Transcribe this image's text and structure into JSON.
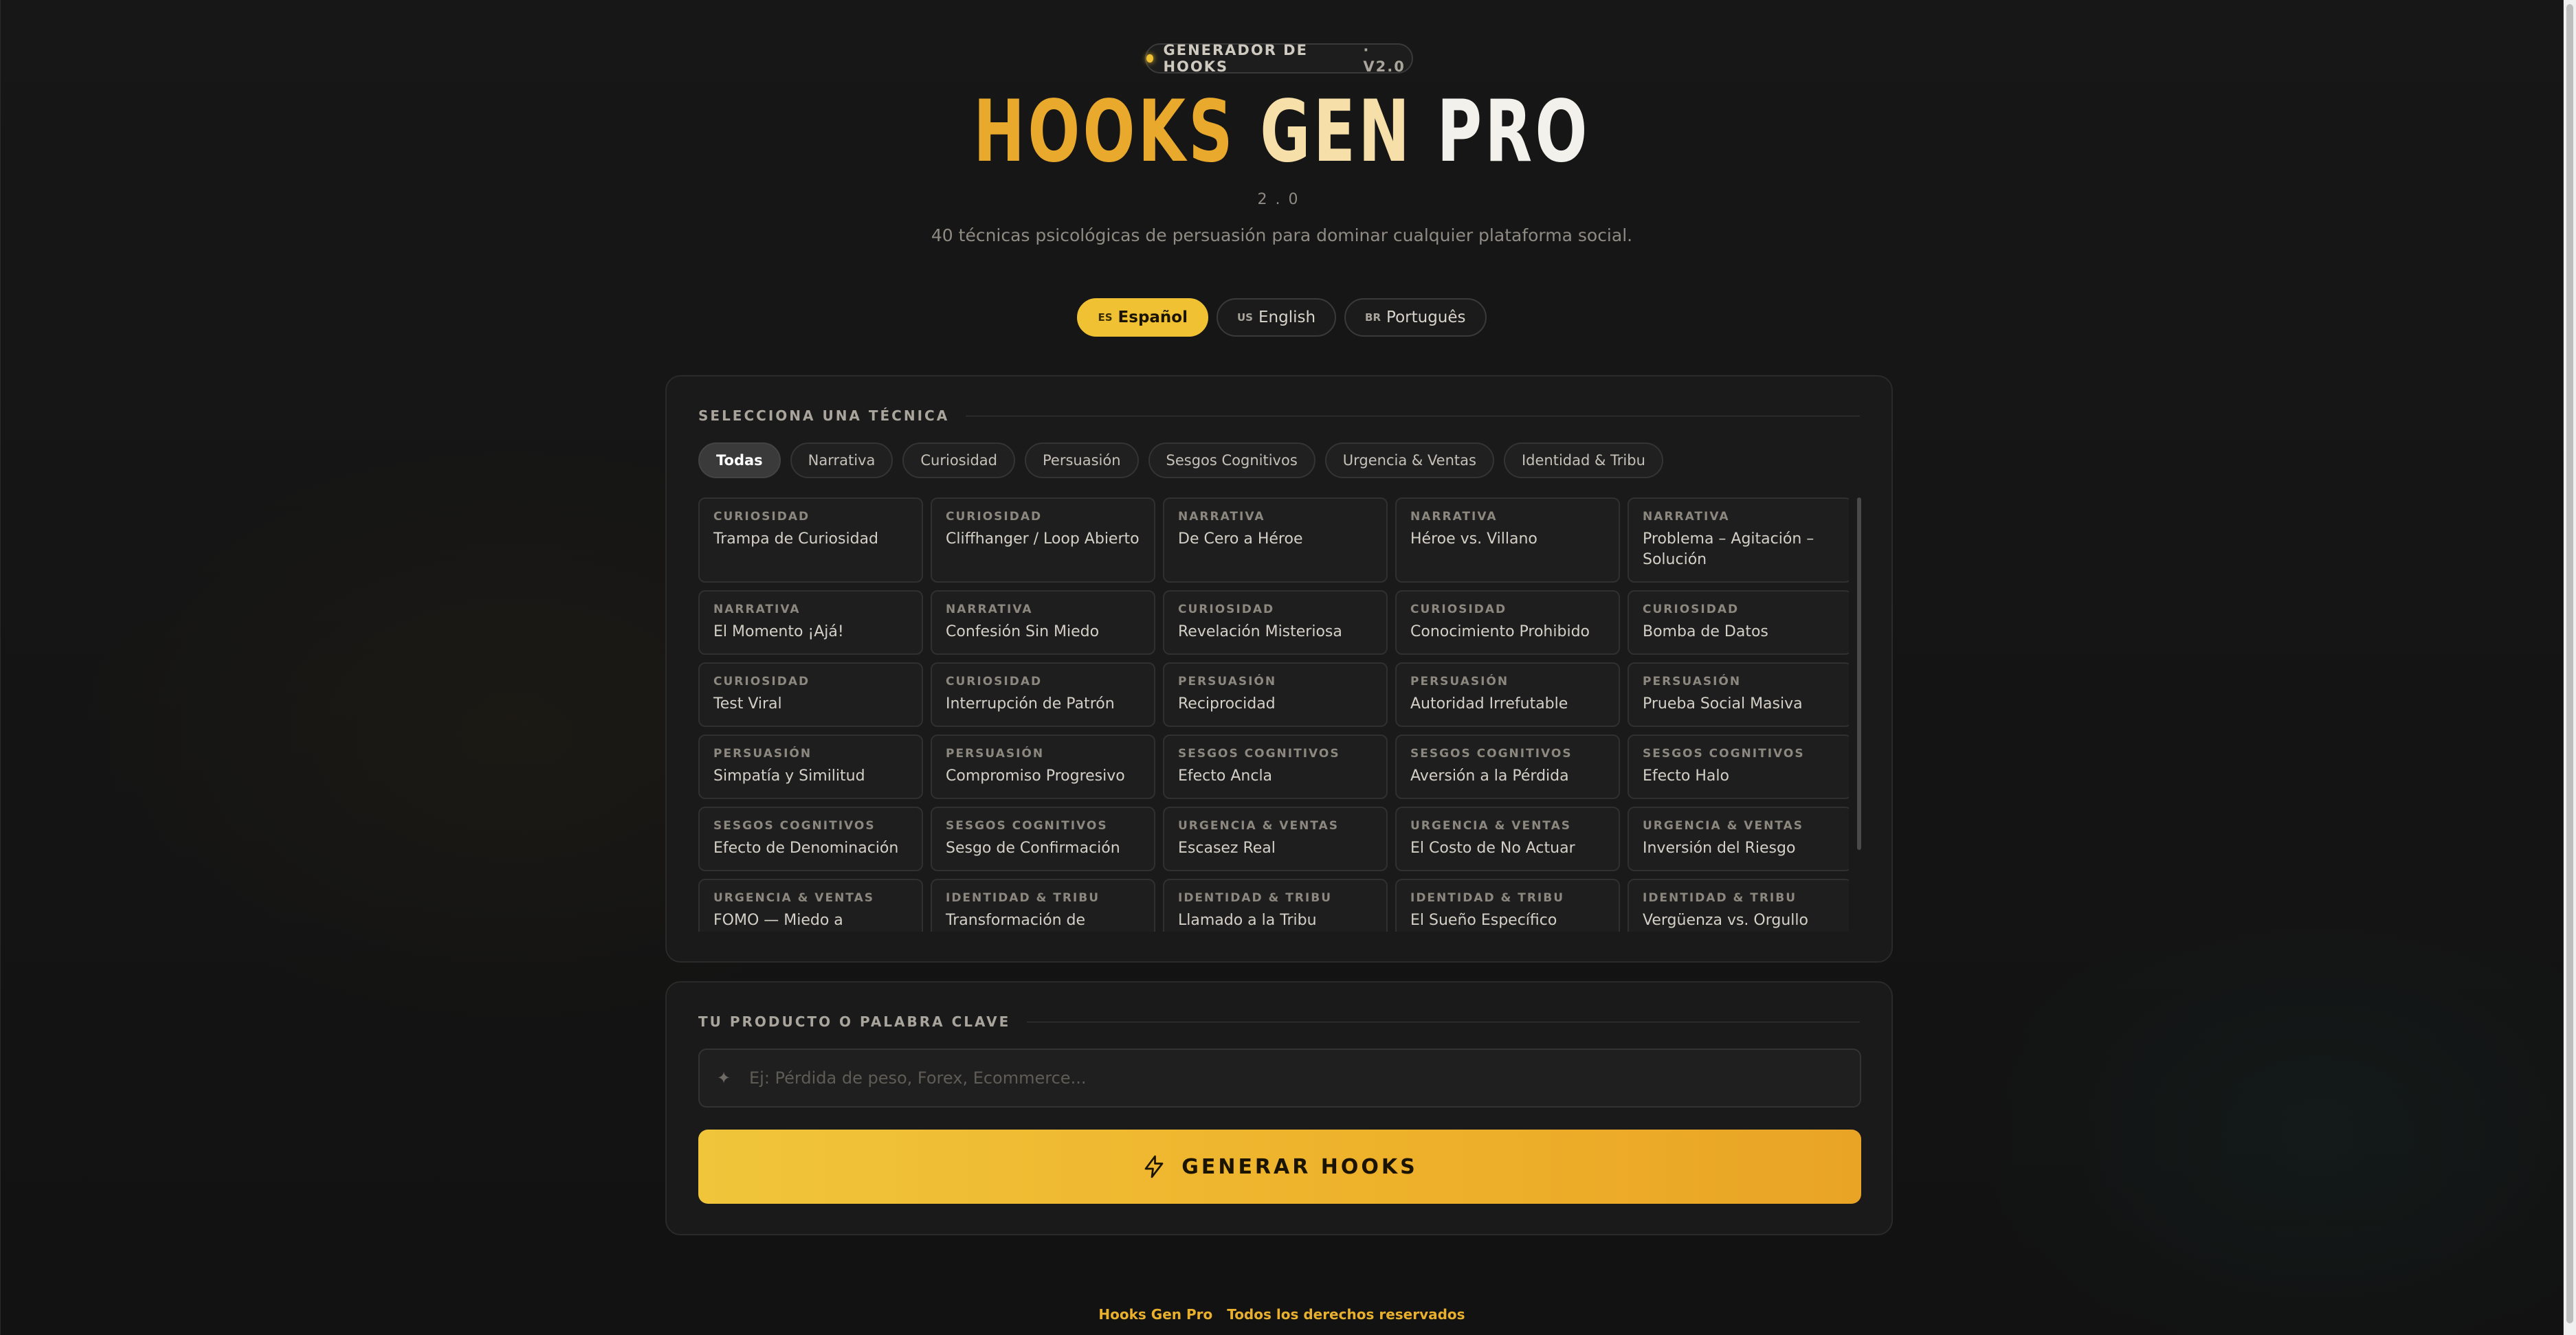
{
  "header": {
    "badge_label": "GENERADOR DE HOOKS",
    "badge_version": "· V2.0",
    "title_part1": "HOOKS",
    "title_part2": "GEN",
    "title_part3": "PRO",
    "subversion": "2.0",
    "tagline": "40 técnicas psicológicas de persuasión para dominar cualquier plataforma social."
  },
  "languages": [
    {
      "flag": "ES",
      "label": "Español",
      "active": true
    },
    {
      "flag": "US",
      "label": "English",
      "active": false
    },
    {
      "flag": "BR",
      "label": "Português",
      "active": false
    }
  ],
  "technique_section": {
    "title": "SELECCIONA UNA TÉCNICA",
    "filters": [
      "Todas",
      "Narrativa",
      "Curiosidad",
      "Persuasión",
      "Sesgos Cognitivos",
      "Urgencia & Ventas",
      "Identidad & Tribu"
    ],
    "active_filter": "Todas",
    "cards": [
      {
        "cat": "CURIOSIDAD",
        "name": "Trampa de Curiosidad"
      },
      {
        "cat": "CURIOSIDAD",
        "name": "Cliffhanger / Loop Abierto"
      },
      {
        "cat": "NARRATIVA",
        "name": "De Cero a Héroe"
      },
      {
        "cat": "NARRATIVA",
        "name": "Héroe vs. Villano"
      },
      {
        "cat": "NARRATIVA",
        "name": "Problema – Agitación – Solución"
      },
      {
        "cat": "NARRATIVA",
        "name": "El Momento ¡Ajá!"
      },
      {
        "cat": "NARRATIVA",
        "name": "Confesión Sin Miedo"
      },
      {
        "cat": "CURIOSIDAD",
        "name": "Revelación Misteriosa"
      },
      {
        "cat": "CURIOSIDAD",
        "name": "Conocimiento Prohibido"
      },
      {
        "cat": "CURIOSIDAD",
        "name": "Bomba de Datos"
      },
      {
        "cat": "CURIOSIDAD",
        "name": "Test Viral"
      },
      {
        "cat": "CURIOSIDAD",
        "name": "Interrupción de Patrón"
      },
      {
        "cat": "PERSUASIÓN",
        "name": "Reciprocidad"
      },
      {
        "cat": "PERSUASIÓN",
        "name": "Autoridad Irrefutable"
      },
      {
        "cat": "PERSUASIÓN",
        "name": "Prueba Social Masiva"
      },
      {
        "cat": "PERSUASIÓN",
        "name": "Simpatía y Similitud"
      },
      {
        "cat": "PERSUASIÓN",
        "name": "Compromiso Progresivo"
      },
      {
        "cat": "SESGOS COGNITIVOS",
        "name": "Efecto Ancla"
      },
      {
        "cat": "SESGOS COGNITIVOS",
        "name": "Aversión a la Pérdida"
      },
      {
        "cat": "SESGOS COGNITIVOS",
        "name": "Efecto Halo"
      },
      {
        "cat": "SESGOS COGNITIVOS",
        "name": "Efecto de Denominación"
      },
      {
        "cat": "SESGOS COGNITIVOS",
        "name": "Sesgo de Confirmación"
      },
      {
        "cat": "URGENCIA & VENTAS",
        "name": "Escasez Real"
      },
      {
        "cat": "URGENCIA & VENTAS",
        "name": "El Costo de No Actuar"
      },
      {
        "cat": "URGENCIA & VENTAS",
        "name": "Inversión del Riesgo"
      },
      {
        "cat": "URGENCIA & VENTAS",
        "name": "FOMO — Miedo a Quedarse"
      },
      {
        "cat": "IDENTIDAD & TRIBU",
        "name": "Transformación de Identidad"
      },
      {
        "cat": "IDENTIDAD & TRIBU",
        "name": "Llamado a la Tribu"
      },
      {
        "cat": "IDENTIDAD & TRIBU",
        "name": "El Sueño Específico"
      },
      {
        "cat": "IDENTIDAD & TRIBU",
        "name": "Vergüenza vs. Orgullo"
      }
    ]
  },
  "product_section": {
    "title": "TU PRODUCTO O PALABRA CLAVE",
    "input_placeholder": "Ej: Pérdida de peso, Forex, Ecommerce...",
    "input_value": "",
    "spark_icon": "sparkle-icon",
    "button_label": "GENERAR HOOKS",
    "button_icon": "lightning-icon"
  },
  "footer": {
    "brand": "Hooks Gen Pro",
    "rights": "Todos los derechos reservados"
  },
  "colors": {
    "accent": "#f0c233",
    "background": "#131313",
    "panel": "#1b1b1b"
  }
}
